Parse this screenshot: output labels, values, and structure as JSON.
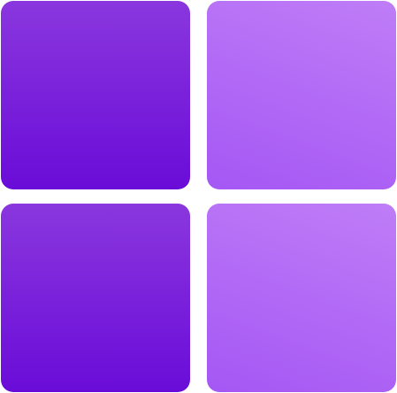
{
  "logo": {
    "icon": "windows-11-logo-icon",
    "tiles": [
      {
        "position": "top-left",
        "color_top": "#8a37de",
        "color_bottom": "#6a0cd8"
      },
      {
        "position": "top-right",
        "color_top": "#bf7df7",
        "color_bottom": "#a557f4"
      },
      {
        "position": "bottom-left",
        "color_top": "#8a37de",
        "color_bottom": "#6a0cd8"
      },
      {
        "position": "bottom-right",
        "color_top": "#bf7df7",
        "color_bottom": "#a557f4"
      }
    ]
  }
}
